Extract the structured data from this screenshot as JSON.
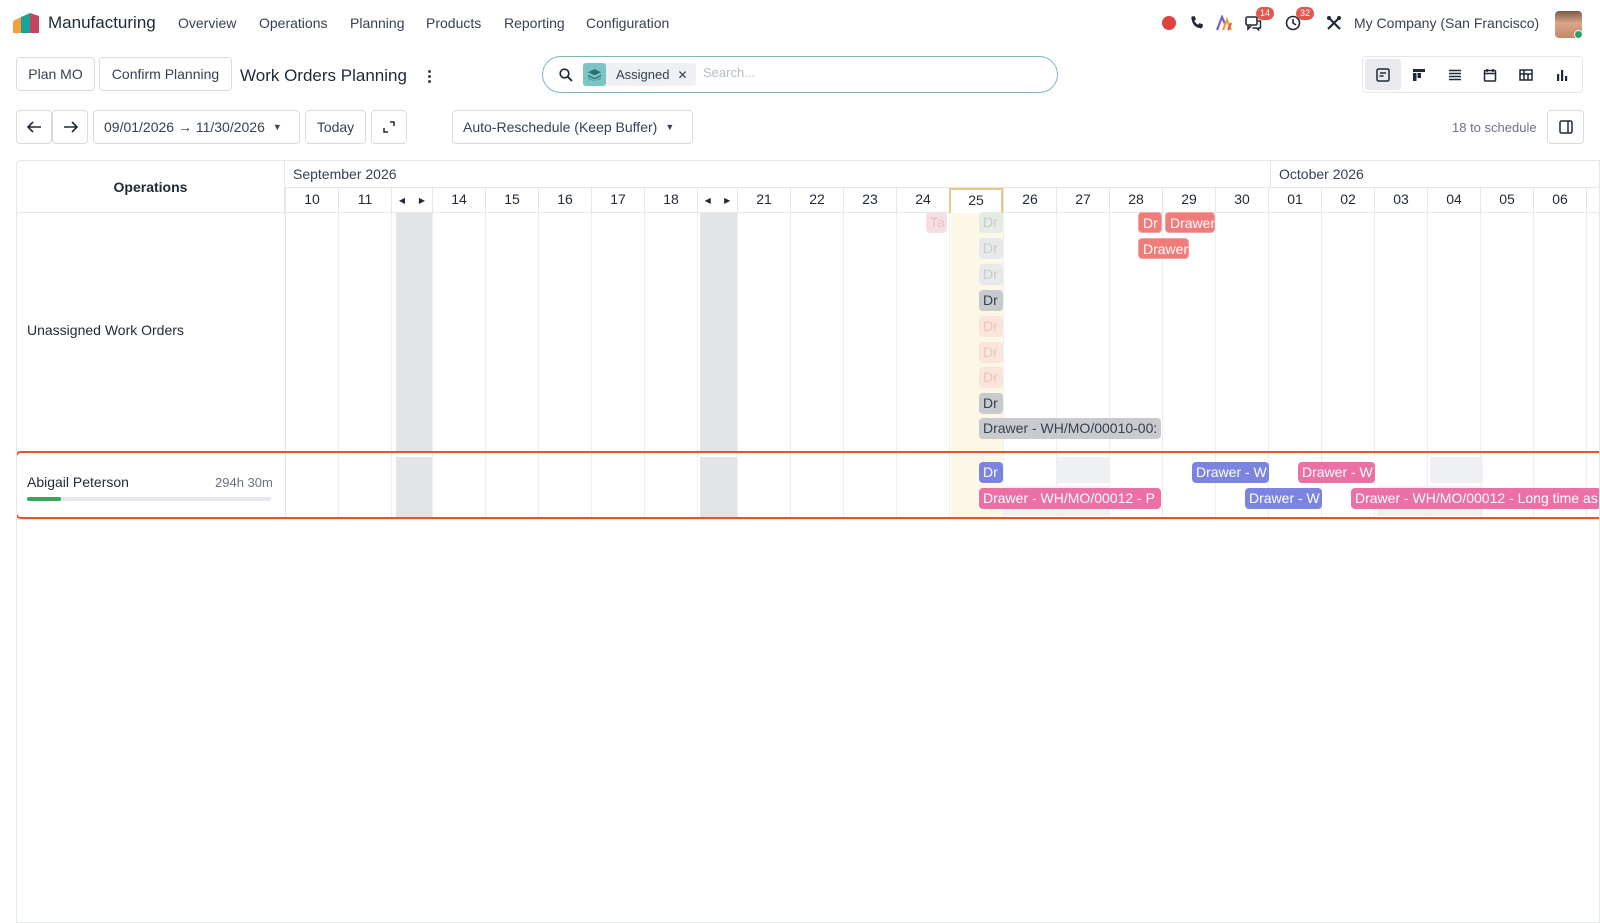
{
  "topbar": {
    "app_name": "Manufacturing",
    "menu": [
      "Overview",
      "Operations",
      "Planning",
      "Products",
      "Reporting",
      "Configuration"
    ],
    "icons": [
      "record-icon",
      "phone-icon",
      "ai-icon",
      "messages-icon",
      "activity-clock-icon",
      "debug-tools-icon"
    ],
    "messages_badge": "14",
    "activity_badge": "32",
    "company": "My Company (San Francisco)",
    "record_color": "#e0433d"
  },
  "control": {
    "plan_mo": "Plan MO",
    "confirm_planning": "Confirm Planning",
    "title": "Work Orders Planning",
    "search_facet": "Assigned",
    "search_placeholder": "Search...",
    "views": [
      "gantt-view-icon",
      "kanban-view-icon",
      "list-view-icon",
      "calendar-view-icon",
      "pivot-view-icon",
      "graph-view-icon"
    ],
    "active_view": "gantt-view-icon"
  },
  "toolbar": {
    "date_range": "09/01/2026 → 11/30/2026",
    "today": "Today",
    "reschedule": "Auto-Reschedule (Keep Buffer)",
    "to_schedule": "18 to schedule"
  },
  "gantt": {
    "header_label": "Operations",
    "months": [
      {
        "label": "September 2026"
      },
      {
        "label": "October 2026"
      }
    ],
    "days": [
      "10",
      "11",
      "14",
      "15",
      "16",
      "17",
      "18",
      "21",
      "22",
      "23",
      "24",
      "25",
      "26",
      "27",
      "28",
      "29",
      "30",
      "01",
      "02",
      "03",
      "04",
      "05",
      "06"
    ],
    "today_day": "25",
    "rows": [
      {
        "label": "Unassigned Work Orders"
      },
      {
        "label": "Abigail Peterson",
        "hours": "294h 30m",
        "progress_percent": 14
      }
    ],
    "unassigned_pills": [
      {
        "text": "Ta",
        "style": "pink-fade"
      },
      {
        "text": "Dr",
        "style": "greenfade"
      },
      {
        "text": "Dr",
        "style": "gfade"
      },
      {
        "text": "Dr",
        "style": "gfade"
      },
      {
        "text": "Dr",
        "style": "grey"
      },
      {
        "text": "Dr",
        "style": "orange-fade"
      },
      {
        "text": "Dr",
        "style": "orange-fade"
      },
      {
        "text": "Dr",
        "style": "orange-fade"
      },
      {
        "text": "Dr",
        "style": "grey"
      },
      {
        "text": "Drawer - WH/MO/00010-00:",
        "style": "grey"
      },
      {
        "text": "Dr",
        "style": "red"
      },
      {
        "text": "Drawer",
        "style": "red"
      },
      {
        "text": "Drawer",
        "style": "red"
      }
    ],
    "abigail_pills": [
      {
        "text": "Dr",
        "style": "blue"
      },
      {
        "text": "Drawer - WH/MO/00012 - P",
        "style": "pink"
      },
      {
        "text": "Drawer - W",
        "style": "blue"
      },
      {
        "text": "Drawer - W",
        "style": "blue"
      },
      {
        "text": "Drawer - W",
        "style": "pink"
      },
      {
        "text": "Drawer - WH/MO/00012 - Long time as",
        "style": "pink"
      }
    ]
  }
}
